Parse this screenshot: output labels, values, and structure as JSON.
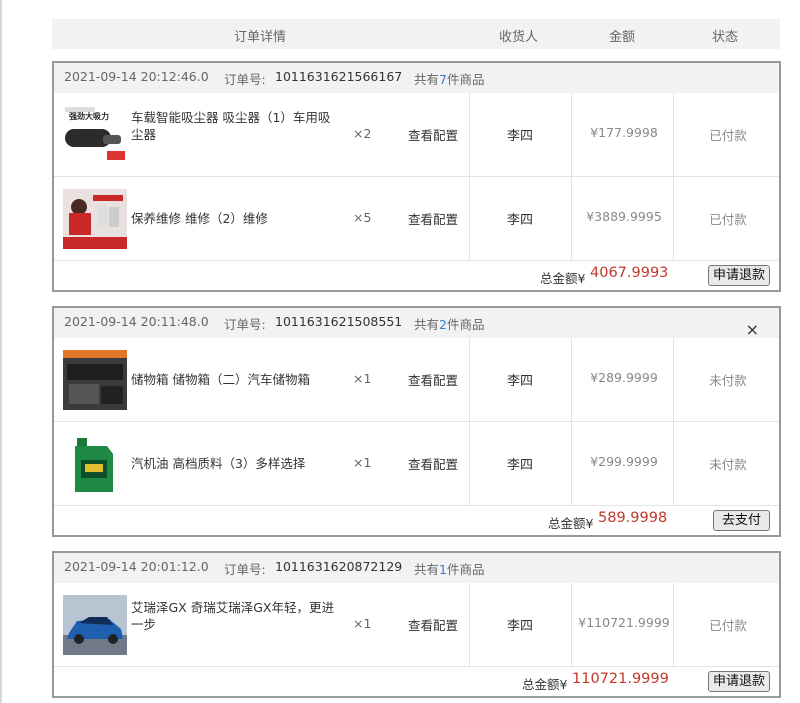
{
  "header": {
    "detail": "订单详情",
    "recv": "收货人",
    "amount": "金额",
    "status": "状态"
  },
  "labels": {
    "order_no": "订单号:",
    "count_prefix": "共有",
    "count_suffix": "件商品",
    "view_config": "查看配置",
    "total": "总金额",
    "currency": "¥"
  },
  "orders": [
    {
      "date": "2021-09-14 20:12:46.0",
      "order_no": "1011631621566167",
      "count": "7",
      "items": [
        {
          "name": "车载智能吸尘器 吸尘器（1）车用吸尘器",
          "qty": "×2",
          "receiver": "李四",
          "price": "¥177.9998",
          "status": "已付款",
          "thumb": "vacuum-image"
        },
        {
          "name": "保养维修 维修（2）维修",
          "qty": "×5",
          "receiver": "李四",
          "price": "¥3889.9995",
          "status": "已付款",
          "thumb": "maintenance-image"
        }
      ],
      "total": "4067.9993",
      "action": "申请退款"
    },
    {
      "date": "2021-09-14 20:11:48.0",
      "order_no": "1011631621508551",
      "count": "2",
      "close": "×",
      "items": [
        {
          "name": "储物箱 储物箱（二）汽车储物箱",
          "qty": "×1",
          "receiver": "李四",
          "price": "¥289.9999",
          "status": "未付款",
          "thumb": "storage-box-image"
        },
        {
          "name": "汽机油 高档质料（3）多样选择",
          "qty": "×1",
          "receiver": "李四",
          "price": "¥299.9999",
          "status": "未付款",
          "thumb": "engine-oil-image"
        }
      ],
      "total": "589.9998",
      "action": "去支付"
    },
    {
      "date": "2021-09-14 20:01:12.0",
      "order_no": "1011631620872129",
      "count": "1",
      "items": [
        {
          "name": "艾瑞泽GX 奇瑞艾瑞泽GX年轻，更进一步",
          "qty": "×1",
          "receiver": "李四",
          "price": "¥110721.9999",
          "status": "已付款",
          "thumb": "car-image"
        }
      ],
      "total": "110721.9999",
      "action": "申请退款"
    }
  ],
  "colors": {
    "accent_red": "#c0392b",
    "count_blue": "#3a7bd5",
    "header_bg": "#f2f2f2"
  }
}
